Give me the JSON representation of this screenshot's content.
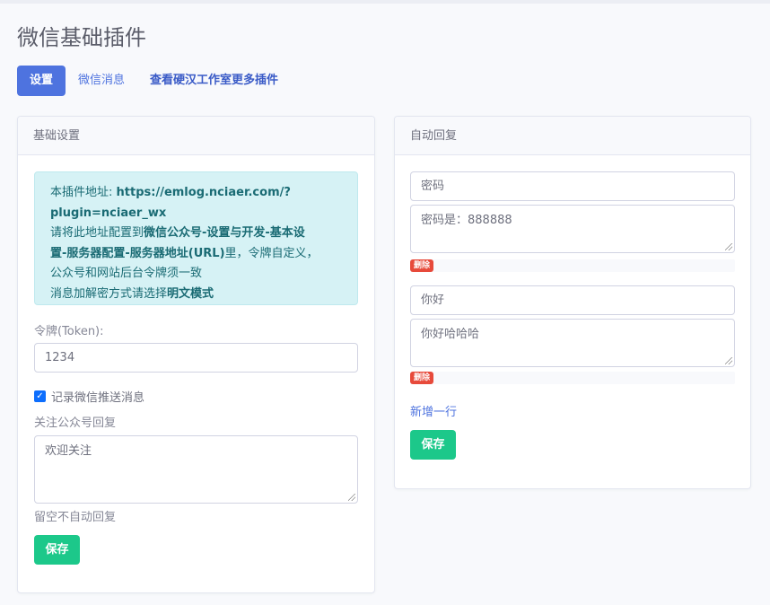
{
  "page": {
    "title": "微信基础插件"
  },
  "tabs": [
    {
      "label": "设置"
    },
    {
      "label": "微信消息"
    },
    {
      "label": "查看硬汉工作室更多插件"
    }
  ],
  "basic": {
    "header": "基础设置",
    "alert": {
      "l1_prefix": "本插件地址: ",
      "l1_url_a": "https://emlog.nciaer.com/?",
      "l1_url_b": "plugin=nciaer_wx",
      "l2_prefix": "请将此地址配置到",
      "l2_bold_a": "微信公众号-设置与开发-基本设",
      "l3_bold_b": "置-服务器配置-服务器地址(URL)",
      "l3_suffix": "里，令牌自定义，",
      "l4": "公众号和网站后台令牌须一致",
      "l5_prefix": "消息加解密方式请选择",
      "l5_bold": "明文模式"
    },
    "token_label": "令牌(Token):",
    "token_value": "1234",
    "record_label": "记录微信推送消息",
    "follow_label": "关注公众号回复",
    "follow_value": "欢迎关注",
    "follow_help": "留空不自动回复",
    "save_label": "保存"
  },
  "auto": {
    "header": "自动回复",
    "rows": [
      {
        "keyword": "密码",
        "reply": "密码是：888888",
        "delete_label": "删除"
      },
      {
        "keyword": "你好",
        "reply": "你好哈哈哈",
        "delete_label": "删除"
      }
    ],
    "add_label": "新增一行",
    "save_label": "保存"
  },
  "colors": {
    "primary": "#4e73df",
    "success": "#1cc88a",
    "danger": "#e74a3b",
    "info_bg": "#d6f2f5"
  }
}
